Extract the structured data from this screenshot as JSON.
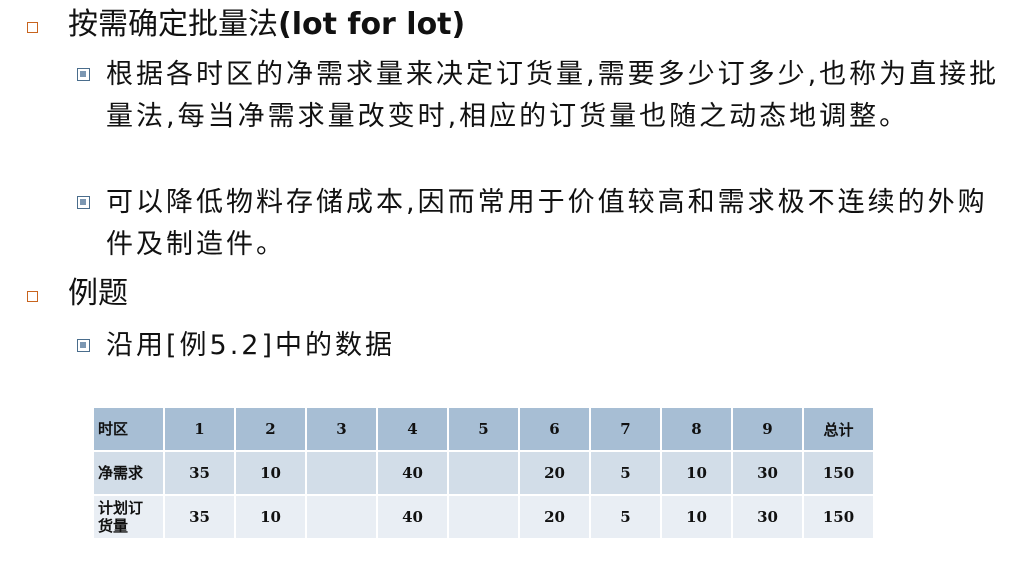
{
  "item1": {
    "title_cn": "按需确定批量法",
    "title_en": "(lot for lot)",
    "sub1": "根据各时区的净需求量来决定订货量,需要多少订多少,也称为直接批量法,每当净需求量改变时,相应的订货量也随之动态地调整。",
    "sub2": "可以降低物料存储成本,因而常用于价值较高和需求极不连续的外购件及制造件。"
  },
  "item2": {
    "title": "例题",
    "sub1": "沿用[例5.2]中的数据"
  },
  "table": {
    "header": [
      "时区",
      "1",
      "2",
      "3",
      "4",
      "5",
      "6",
      "7",
      "8",
      "9",
      "总计"
    ],
    "rows": [
      [
        "净需求",
        "35",
        "10",
        "",
        "40",
        "",
        "20",
        "5",
        "10",
        "30",
        "150"
      ],
      [
        "计划订货量",
        "35",
        "10",
        "",
        "40",
        "",
        "20",
        "5",
        "10",
        "30",
        "150"
      ]
    ]
  },
  "colors": {
    "bullet_level1": "#c8641e",
    "bullet_level2": "#4a6d8c",
    "table_header": "#a7bed4",
    "table_row1": "#d2dde8",
    "table_row2": "#e9eef4"
  }
}
